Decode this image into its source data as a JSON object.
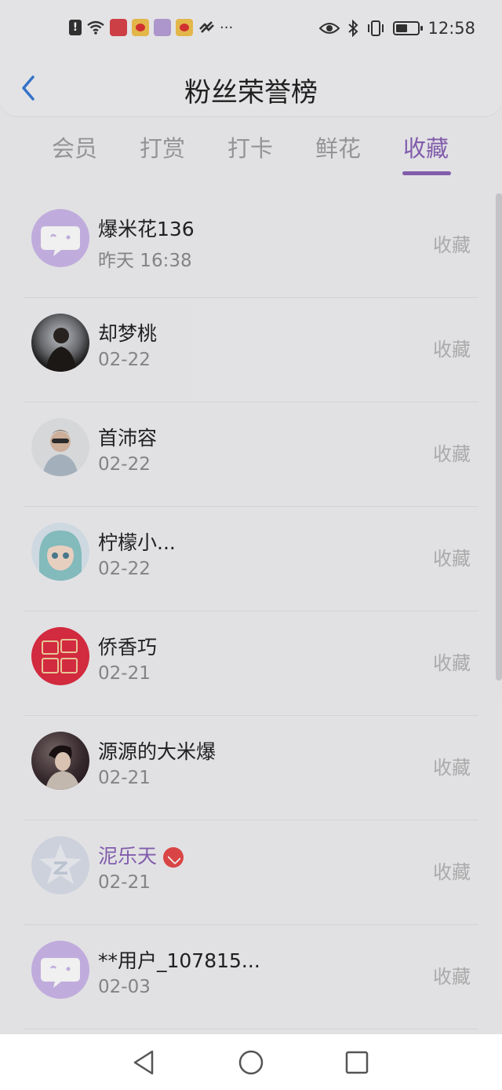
{
  "status_bar": {
    "time": "12:58",
    "left_icons": [
      "alert-icon",
      "wifi-icon",
      "app-icon-red",
      "weibo-icon",
      "app-icon-purple",
      "weibo-icon",
      "signal-icon"
    ],
    "more": "···",
    "right_icons": [
      "eye-icon",
      "bluetooth-icon",
      "vibrate-icon",
      "battery-icon"
    ]
  },
  "header": {
    "title": "粉丝荣誉榜",
    "back_icon": "chevron-left-icon"
  },
  "tabs": [
    {
      "label": "会员",
      "active": false
    },
    {
      "label": "打赏",
      "active": false
    },
    {
      "label": "打卡",
      "active": false
    },
    {
      "label": "鲜花",
      "active": false
    },
    {
      "label": "收藏",
      "active": true
    }
  ],
  "accent_color": "#8a62b6",
  "list": [
    {
      "name": "爆米花136",
      "date": "昨天 16:38",
      "action": "收藏",
      "avatar": "default-chat-avatar"
    },
    {
      "name": "却梦桃",
      "date": "02-22",
      "action": "收藏",
      "avatar": "photo-avatar"
    },
    {
      "name": "首沛容",
      "date": "02-22",
      "action": "收藏",
      "avatar": "photo-avatar"
    },
    {
      "name": "柠檬小...",
      "date": "02-22",
      "action": "收藏",
      "avatar": "anime-avatar"
    },
    {
      "name": "侨香巧",
      "date": "02-21",
      "action": "收藏",
      "avatar": "exam-avatar"
    },
    {
      "name": "源源的大米爆",
      "date": "02-21",
      "action": "收藏",
      "avatar": "photo-avatar"
    },
    {
      "name": "泥乐天",
      "date": "02-21",
      "action": "收藏",
      "avatar": "qq-star-avatar",
      "vip": true
    },
    {
      "name": "**用户_107815...",
      "date": "02-03",
      "action": "收藏",
      "avatar": "default-chat-avatar"
    }
  ],
  "nav_bar": [
    "back-triangle-icon",
    "home-circle-icon",
    "recents-square-icon"
  ]
}
